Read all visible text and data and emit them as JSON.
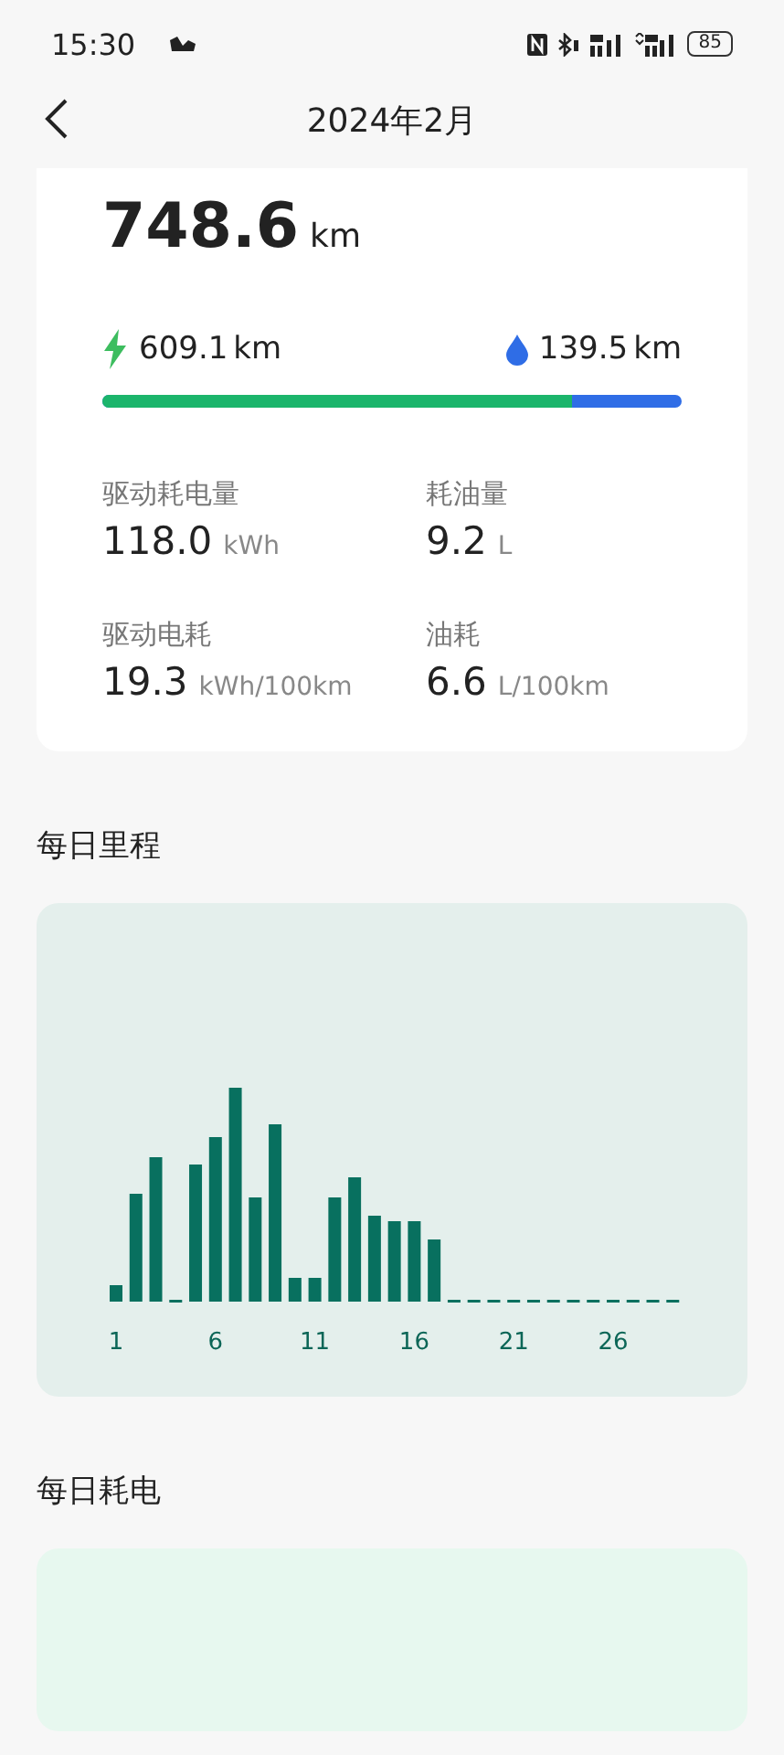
{
  "status_bar": {
    "time": "15:30",
    "battery": "85"
  },
  "header": {
    "title": "2024年2月"
  },
  "summary": {
    "total_value": "748.6",
    "total_unit": "km",
    "electric": {
      "value": "609.1",
      "unit": "km"
    },
    "fuel": {
      "value": "139.5",
      "unit": "km"
    },
    "split": {
      "level": 0.81
    },
    "stats": [
      {
        "label": "驱动耗电量",
        "value": "118.0",
        "unit": "kWh"
      },
      {
        "label": "耗油量",
        "value": "9.2",
        "unit": "L"
      },
      {
        "label": "驱动电耗",
        "value": "19.3",
        "unit": "kWh/100km"
      },
      {
        "label": "油耗",
        "value": "6.6",
        "unit": "L/100km"
      }
    ]
  },
  "daily_distance": {
    "title": "每日里程",
    "day_labels": [
      "1",
      "6",
      "11",
      "16",
      "21",
      "26"
    ]
  },
  "daily_energy": {
    "title": "每日耗电"
  }
}
